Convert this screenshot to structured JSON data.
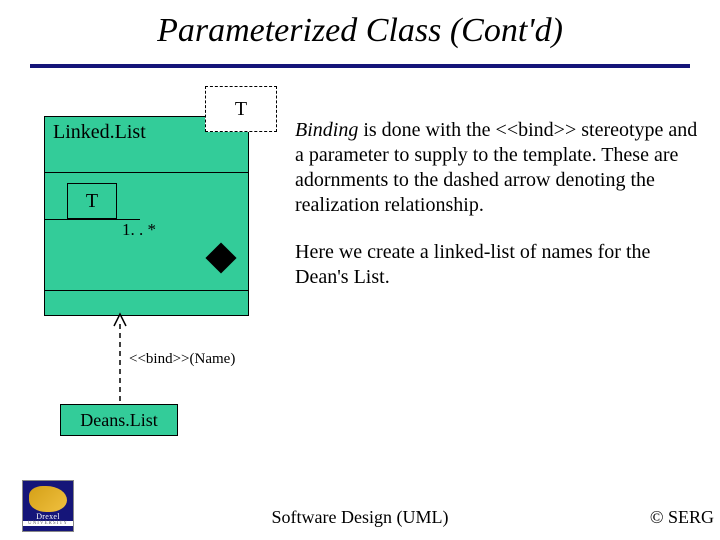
{
  "title": "Parameterized Class (Cont'd)",
  "diagram": {
    "template_class": "Linked.List",
    "template_param": "T",
    "inner_param": "T",
    "multiplicity": "1. . *",
    "bind_label": "<<bind>>(Name)",
    "bound_class": "Deans.List"
  },
  "explain": {
    "p1_lead": "Binding",
    "p1_rest": " is done with the <<bind>> stereotype and a parameter to supply to the template. These are adornments to the dashed arrow denoting the realization relationship.",
    "p2": "Here we create a linked-list of names for the Dean's List."
  },
  "footer": {
    "center": "Software Design (UML)",
    "right": "© SERG",
    "logo_name": "Drexel",
    "logo_sub": "UNIVERSITY"
  },
  "colors": {
    "accent": "#151579",
    "class_fill": "#33cc99"
  }
}
